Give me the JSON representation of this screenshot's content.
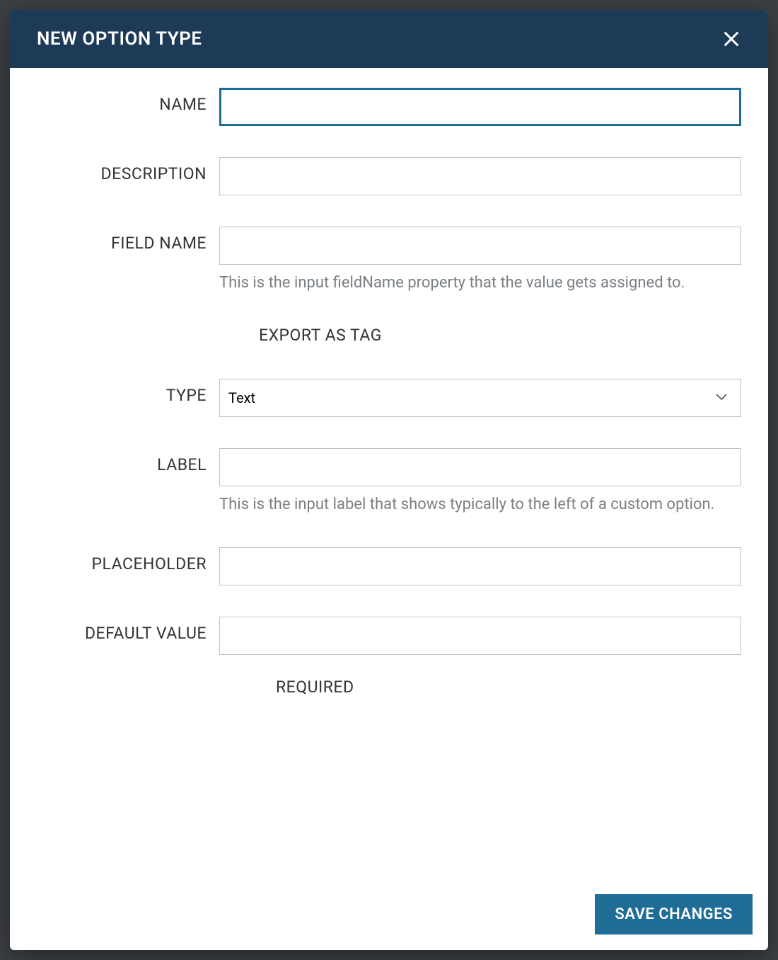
{
  "modal": {
    "title": "NEW OPTION TYPE",
    "save_label": "SAVE CHANGES"
  },
  "form": {
    "name": {
      "label": "NAME",
      "value": ""
    },
    "description": {
      "label": "DESCRIPTION",
      "value": ""
    },
    "field_name": {
      "label": "FIELD NAME",
      "value": "",
      "help": "This is the input fieldName property that the value gets assigned to."
    },
    "export_as_tag": {
      "label": "EXPORT AS TAG"
    },
    "type": {
      "label": "TYPE",
      "value": "Text"
    },
    "label_field": {
      "label": "LABEL",
      "value": "",
      "help": "This is the input label that shows typically to the left of a custom option."
    },
    "placeholder": {
      "label": "PLACEHOLDER",
      "value": ""
    },
    "default_value": {
      "label": "DEFAULT VALUE",
      "value": ""
    },
    "required": {
      "label": "REQUIRED"
    }
  }
}
